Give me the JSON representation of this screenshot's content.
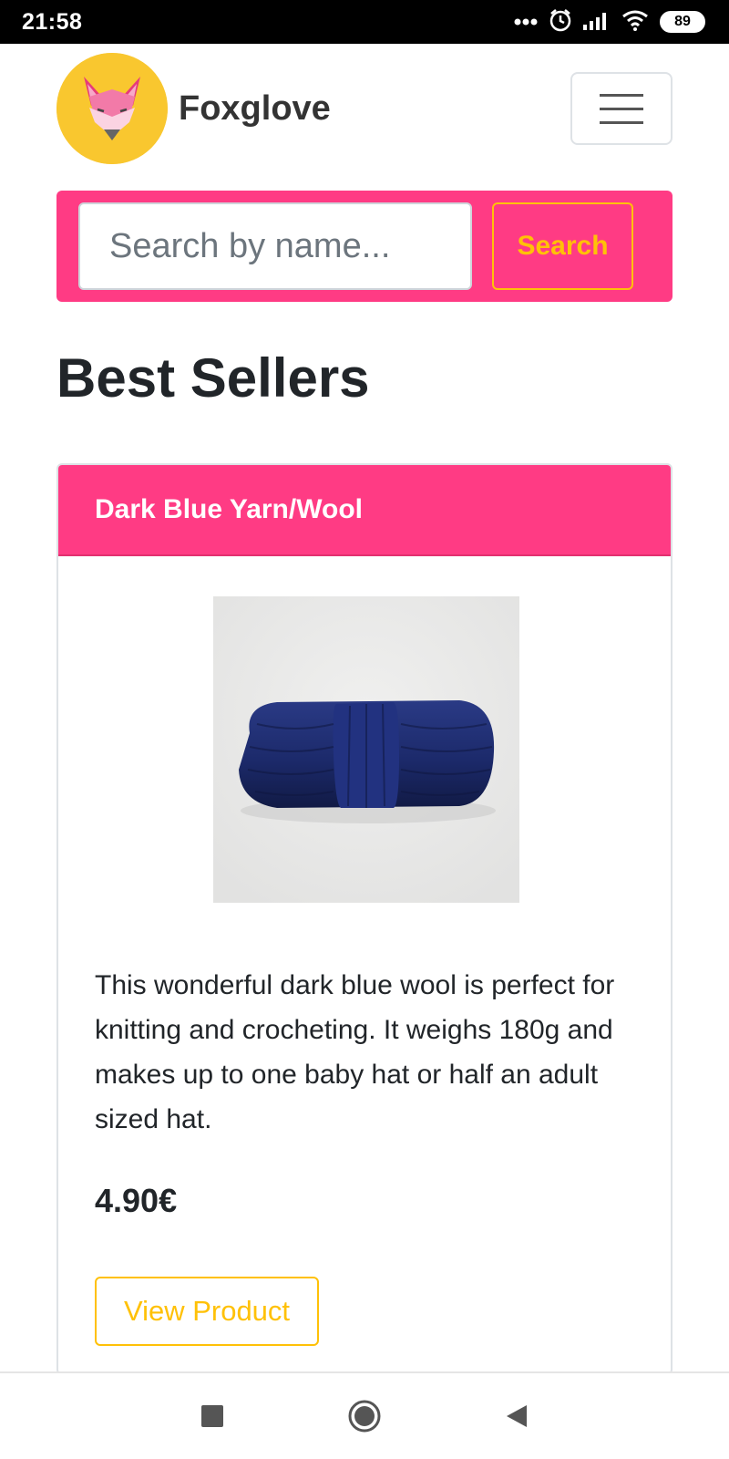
{
  "status_bar": {
    "time": "21:58",
    "battery": "89",
    "icons": [
      "more-dots-icon",
      "alarm-icon",
      "signal-icon",
      "wifi-icon",
      "battery-icon"
    ]
  },
  "header": {
    "brand_name": "Foxglove",
    "logo_icon": "fox-logo-icon",
    "menu_icon": "hamburger-menu-icon"
  },
  "search": {
    "placeholder": "Search by name...",
    "button_label": "Search"
  },
  "main": {
    "section_title": "Best Sellers",
    "products": [
      {
        "title": "Dark Blue Yarn/Wool",
        "description": "This wonderful dark blue wool is perfect for knitting and crocheting. It weighs 180g and makes up to one baby hat or half an adult sized hat.",
        "price": "4.90€",
        "button_label": "View Product"
      }
    ]
  },
  "nav_bar": {
    "icons": [
      "recents-square-icon",
      "home-circle-icon",
      "back-triangle-icon"
    ]
  },
  "colors": {
    "accent_pink": "#ff3b84",
    "accent_yellow": "#ffc107",
    "logo_yellow": "#f9c72f",
    "yarn_blue": "#1c2a6b"
  }
}
